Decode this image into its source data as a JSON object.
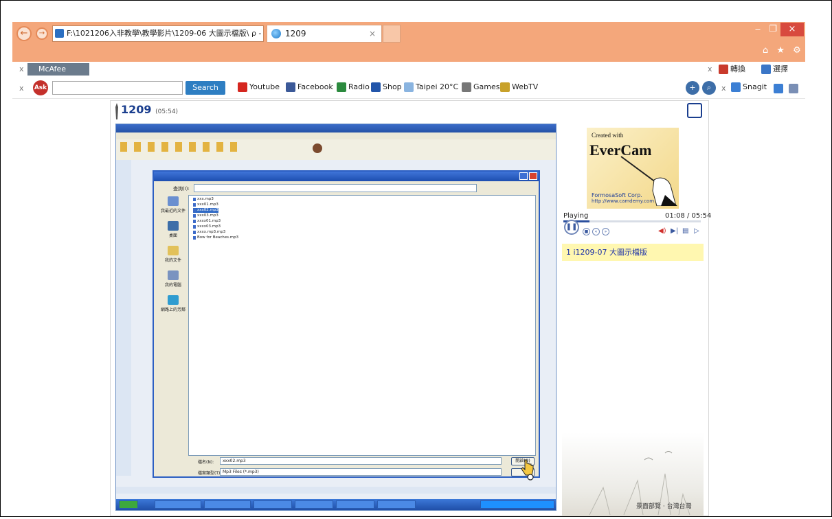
{
  "browser": {
    "address": "F:\\1021206入非教學\\教學影片\\1209-06 大圖示檔版\\ ρ - ↺",
    "tab_title": "1209",
    "tab_close": "×",
    "minimize": "‒",
    "maximize": "❐",
    "close": "×",
    "home_fav_settings": "⌂ ★ ⚙"
  },
  "toolbar1": {
    "x": "x",
    "mcafee": "McAfee",
    "right_x": "x",
    "convert": "轉換",
    "select": "選擇"
  },
  "toolbar2": {
    "x": "x",
    "ask": "Ask",
    "search_label": "Search",
    "items": [
      "Youtube",
      "Facebook",
      "Radio",
      "Shop",
      "Taipei 20°C",
      "Games",
      "WebTV"
    ],
    "right_x": "x",
    "snagit": "Snagit"
  },
  "viewer": {
    "title": "1209",
    "duration": "(05:54)"
  },
  "dialog": {
    "lookin_label": "查詢(I):",
    "nav": [
      "我最近的文件",
      "桌面",
      "我的文件",
      "我的電腦",
      "網路上的芳鄰"
    ],
    "files": [
      "xxx.mp3",
      "xxx01.mp3",
      "xxx02.mp3",
      "xxx03.mp3",
      "xxxx01.mp3",
      "xxxx03.mp3",
      "xxxx.mp3.mp3",
      "Bow for Beaches.mp3"
    ],
    "filename_label": "檔名(N):",
    "filename_value": "xxx02.mp3",
    "filetype_label": "檔案類型(T):",
    "filetype_value": "Mp3 Files (*.mp3)",
    "open_btn": "開啟(O)"
  },
  "player": {
    "created_with": "Created with",
    "brand": "EverCam",
    "corp": "FormosaSoft Corp.",
    "url": "http://www.camdemy.com",
    "status": "Playing",
    "time": "01:08 / 05:54",
    "progress": 0.19,
    "chapter": "1  i1209-07 大圖示檔版"
  },
  "footer": {
    "caption": "景面部覽 · 台灣台灣"
  }
}
